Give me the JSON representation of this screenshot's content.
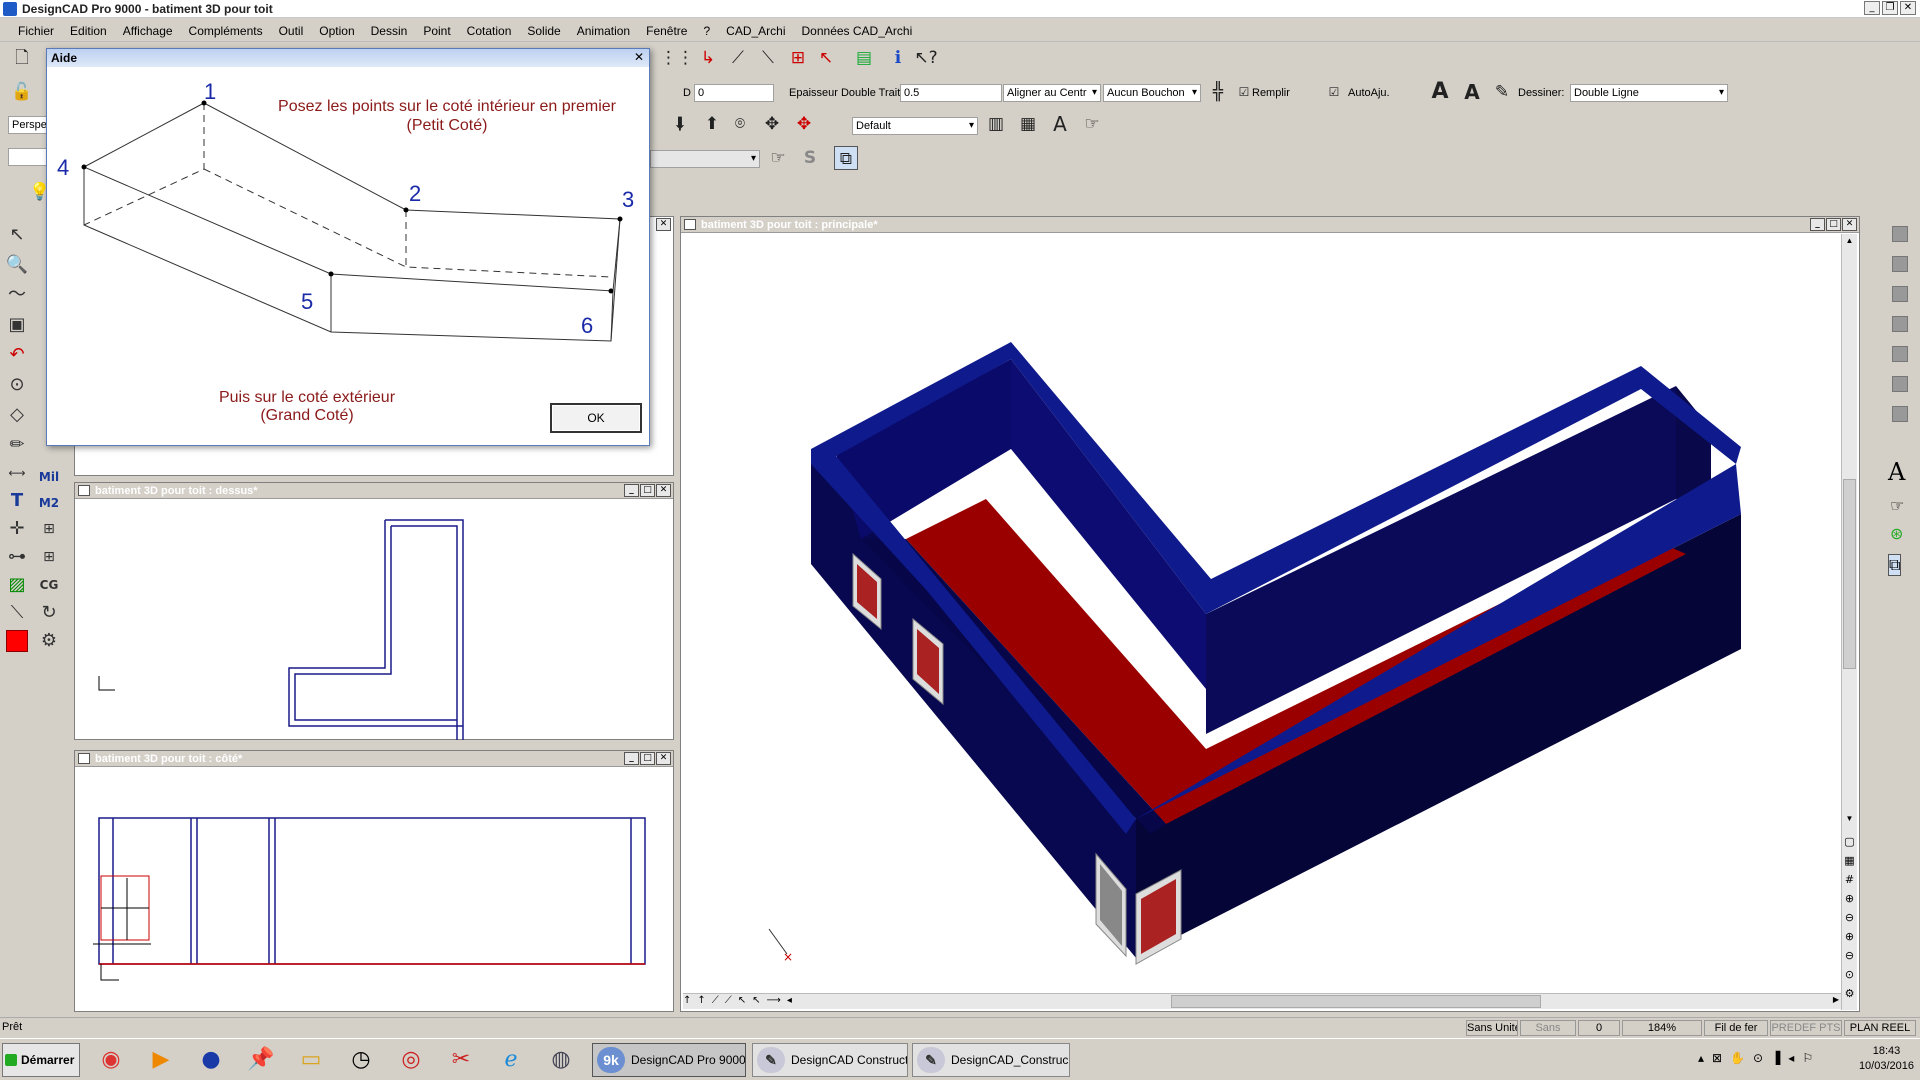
{
  "window": {
    "title": "DesignCAD Pro 9000 - batiment 3D pour toit"
  },
  "menu": [
    "Fichier",
    "Edition",
    "Affichage",
    "Compléments",
    "Outil",
    "Option",
    "Dessin",
    "Point",
    "Cotation",
    "Solide",
    "Animation",
    "Fenêtre",
    "?",
    "CAD_Archi",
    "Données CAD_Archi"
  ],
  "toolbar": {
    "d_label": "D",
    "d_value": "0",
    "epaisseur_label": "Epaisseur Double Trait",
    "epaisseur_value": "0.5",
    "aligner_value": "Aligner au Centr",
    "bouchon_value": "Aucun Bouchon",
    "remplir_label": "Remplir",
    "autoaju_label": "AutoAju.",
    "dessiner_label": "Dessiner:",
    "dessiner_value": "Double Ligne",
    "layer_value": "Default",
    "view_value": "Perspe"
  },
  "dialog": {
    "title": "Aide",
    "text_top_1": "Posez les points sur le coté intérieur en premier",
    "text_top_2": "(Petit Coté)",
    "text_bottom_1": "Puis sur le coté extérieur",
    "text_bottom_2": "(Grand Coté)",
    "ok_label": "OK",
    "point_labels": [
      "1",
      "2",
      "3",
      "4",
      "5",
      "6"
    ],
    "accent": "#8b1a1a"
  },
  "panels": {
    "top": {
      "title": "batiment 3D pour toit : dessus*"
    },
    "side": {
      "title": "batiment 3D pour toit : côté*"
    },
    "main": {
      "title": "batiment 3D pour toit : principale*"
    }
  },
  "status": {
    "left": "Prêt",
    "cells": [
      "Sans Unités",
      "Sans",
      "0",
      "184%",
      "Fil de fer",
      "PREDEF PTS",
      "PLAN REEL"
    ]
  },
  "taskbar": {
    "start_label": "Démarrer",
    "tasks": [
      "DesignCAD Pro 9000 ...",
      "DesignCAD Construct...",
      "DesignCAD_Construc..."
    ],
    "time": "18:43",
    "date": "10/03/2016"
  },
  "colors": {
    "wall": "#0a0a6e",
    "wall_top": "#0f1a8c",
    "floor": "#9b0000",
    "line": "#1a1a8a"
  }
}
